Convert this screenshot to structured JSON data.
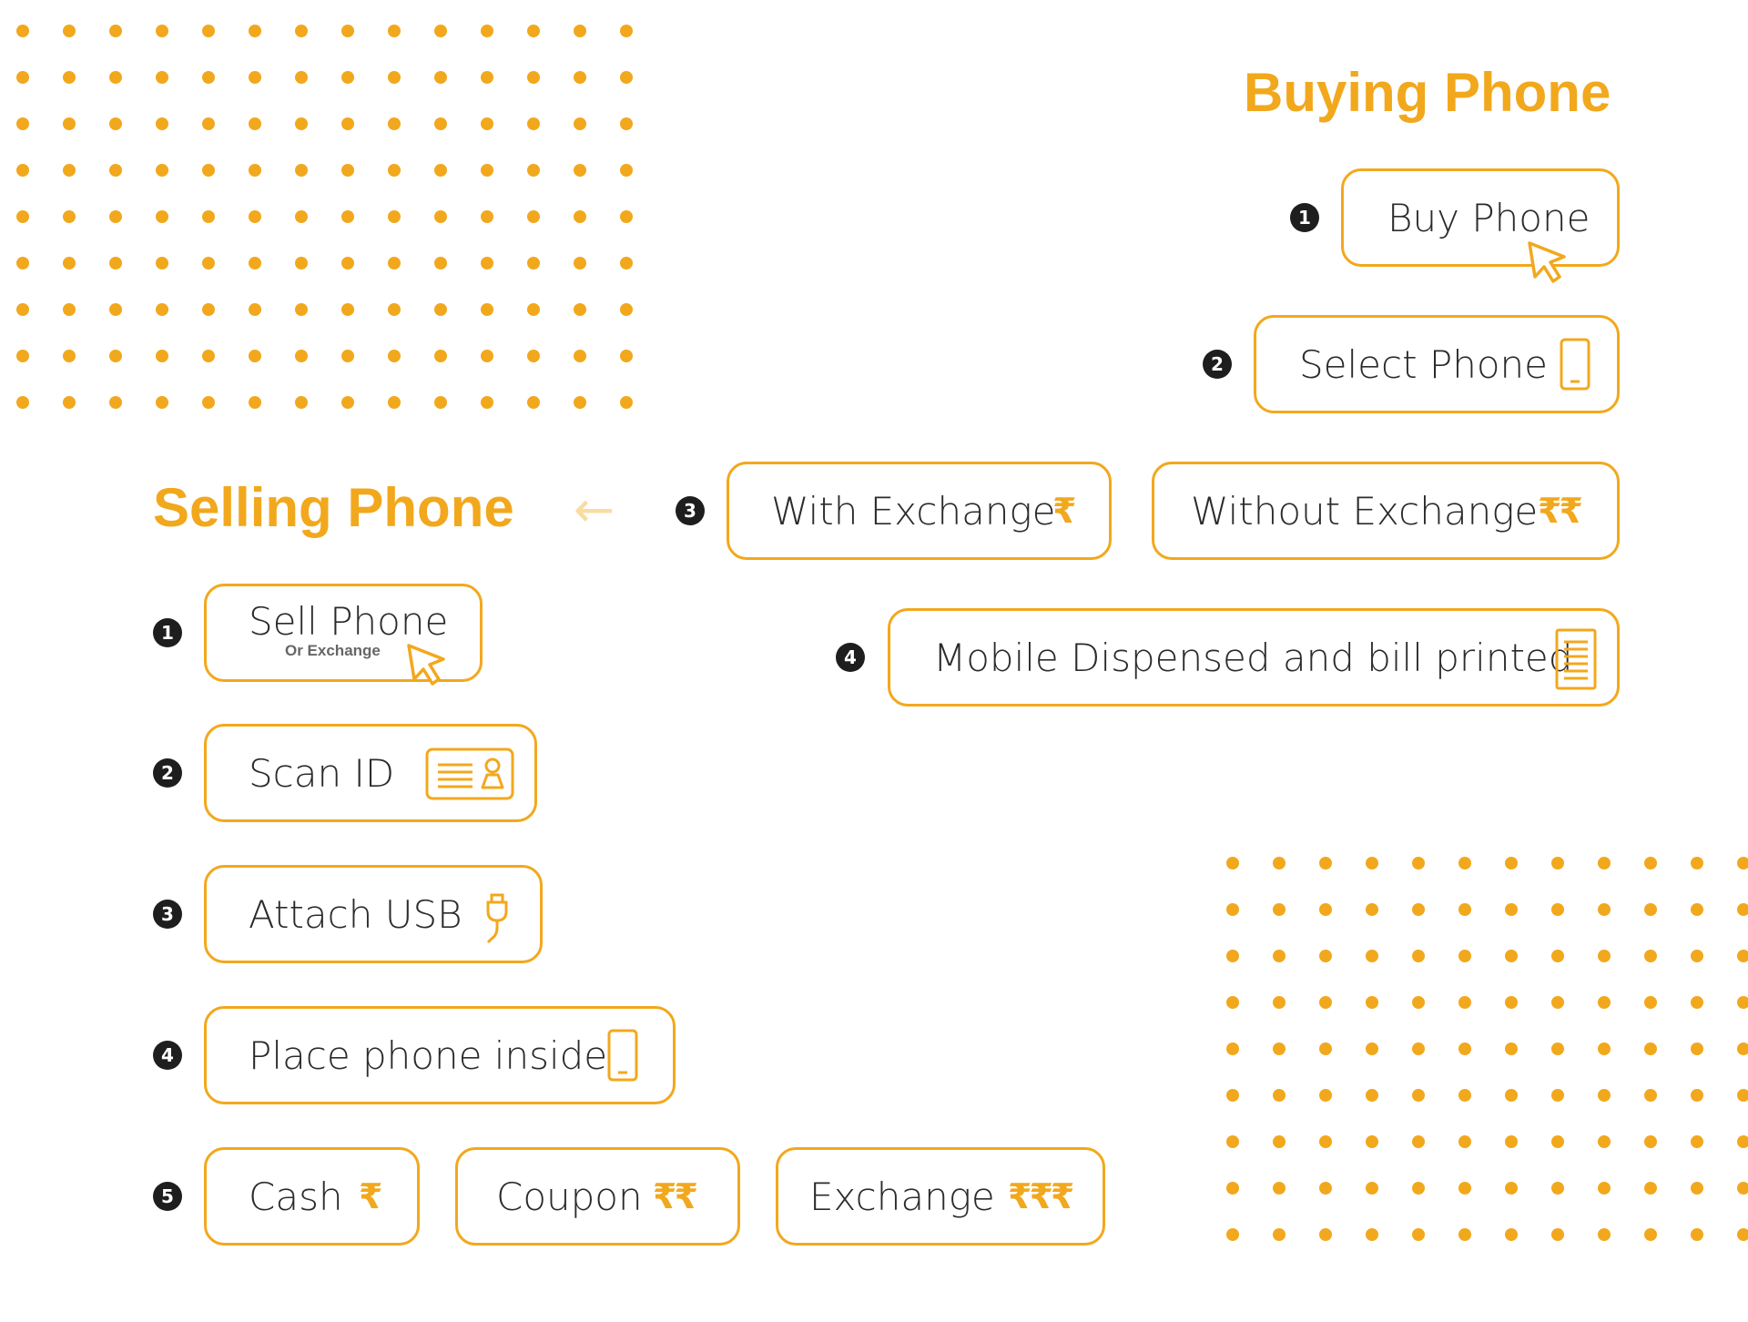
{
  "colors": {
    "accent": "#f2a81d",
    "text": "#2b2b2b",
    "badge": "#1e1e1e"
  },
  "buying": {
    "title": "Buying Phone",
    "steps": {
      "s1": {
        "num": "1",
        "label": "Buy Phone",
        "icon": "cursor-icon"
      },
      "s2": {
        "num": "2",
        "label": "Select Phone",
        "icon": "smartphone-icon"
      },
      "s3": {
        "num": "3",
        "with_label": "With Exchange",
        "with_rupee": "₹",
        "without_label": "Without Exchange",
        "without_rupee": "₹₹"
      },
      "s4": {
        "num": "4",
        "label": "Mobile Dispensed and bill printed",
        "icon": "receipt-icon"
      }
    }
  },
  "selling": {
    "title": "Selling Phone",
    "arrow": "←",
    "steps": {
      "s1": {
        "num": "1",
        "label": "Sell Phone",
        "sublabel": "Or Exchange",
        "icon": "cursor-icon"
      },
      "s2": {
        "num": "2",
        "label": "Scan ID",
        "icon": "id-card-icon"
      },
      "s3": {
        "num": "3",
        "label": "Attach USB",
        "icon": "usb-cable-icon"
      },
      "s4": {
        "num": "4",
        "label": "Place phone inside",
        "icon": "smartphone-icon"
      },
      "s5": {
        "num": "5",
        "cash_label": "Cash",
        "cash_rupee": "₹",
        "coupon_label": "Coupon",
        "coupon_rupee": "₹₹",
        "exchange_label": "Exchange",
        "exchange_rupee": "₹₹₹"
      }
    }
  }
}
